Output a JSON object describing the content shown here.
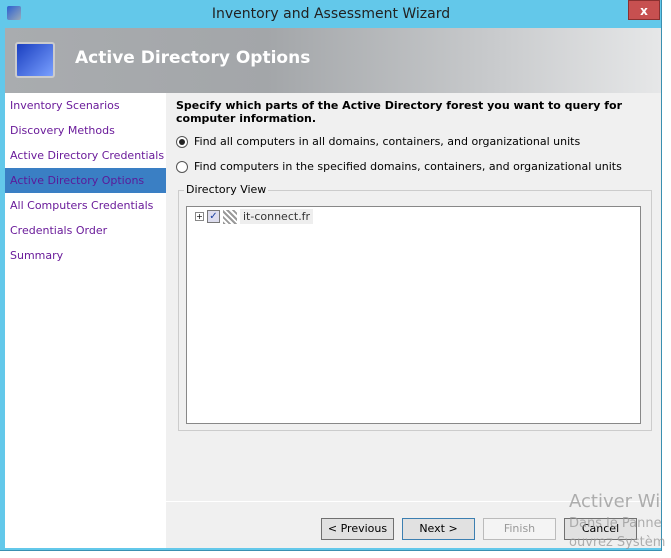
{
  "window": {
    "title": "Inventory and Assessment Wizard",
    "close_label": "x"
  },
  "banner": {
    "title": "Active Directory Options"
  },
  "sidebar": {
    "items": [
      {
        "label": "Inventory Scenarios"
      },
      {
        "label": "Discovery Methods"
      },
      {
        "label": "Active Directory Credentials"
      },
      {
        "label": "Active Directory Options",
        "selected": true
      },
      {
        "label": "All Computers Credentials"
      },
      {
        "label": "Credentials Order"
      },
      {
        "label": "Summary"
      }
    ]
  },
  "main": {
    "question": "Specify which parts of the Active Directory forest you want to query for computer information.",
    "options": [
      {
        "label": "Find all computers in all domains, containers, and organizational units",
        "checked": true
      },
      {
        "label": "Find computers in the specified domains, containers, and organizational units",
        "checked": false
      }
    ],
    "directory_view": {
      "label": "Directory View",
      "nodes": [
        {
          "expander": "+",
          "checked": "✓",
          "label": "it-connect.fr"
        }
      ]
    }
  },
  "buttons": {
    "previous": "< Previous",
    "next": "Next >",
    "finish": "Finish",
    "cancel": "Cancel"
  },
  "watermark": {
    "line1": "Activer Wi",
    "line2": "Dans le Panne",
    "line3": "ouvrez Systèm"
  }
}
